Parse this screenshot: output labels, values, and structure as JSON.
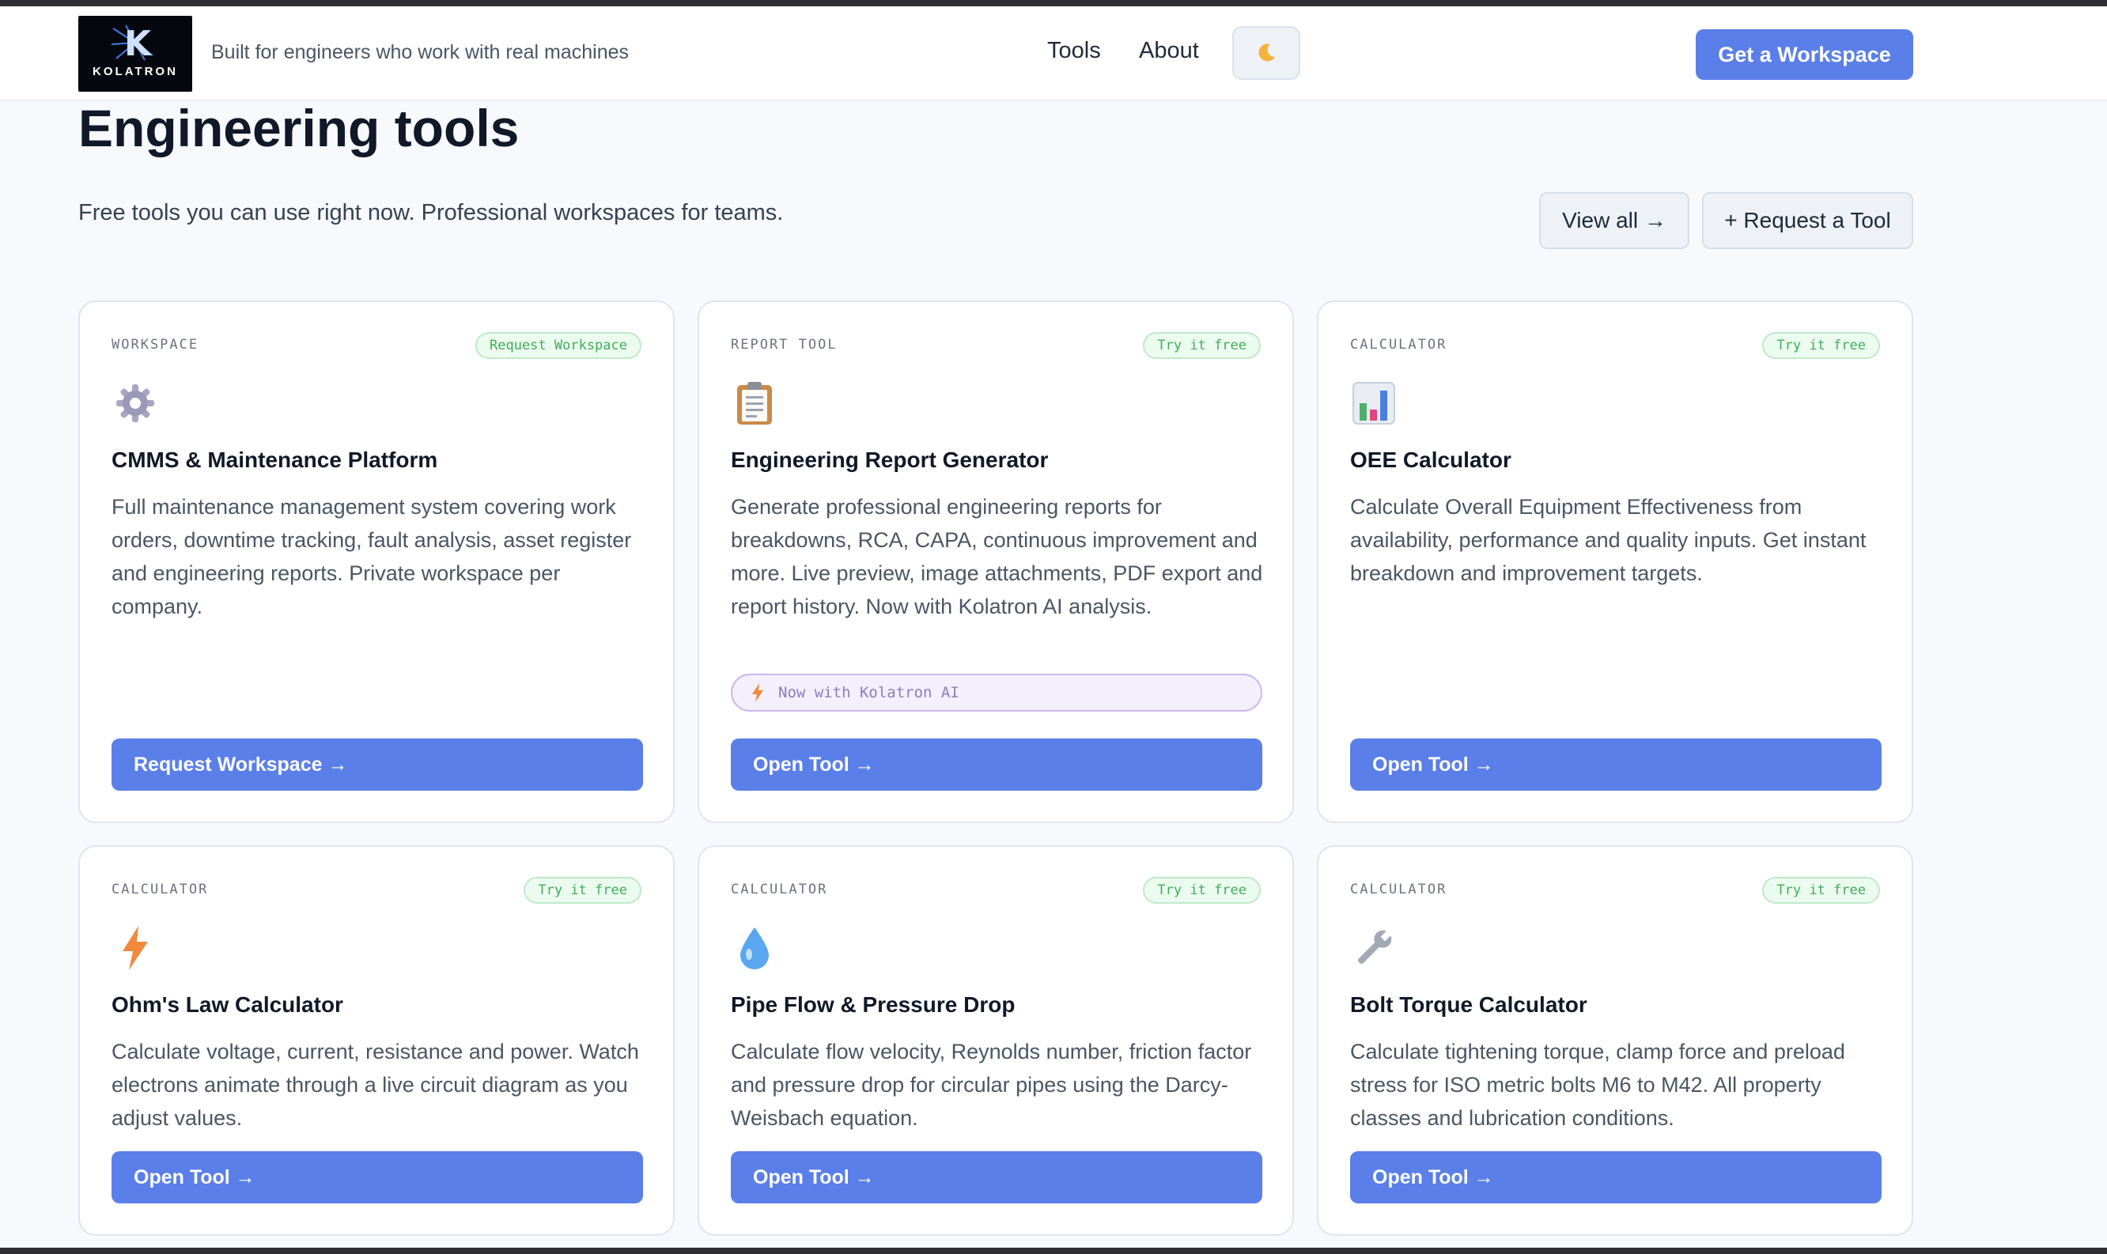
{
  "header": {
    "logo_text": "KOLATRON",
    "tagline": "Built for engineers who work with real machines",
    "nav": [
      "Tools",
      "About"
    ],
    "theme_toggle_icon": "moon-icon",
    "cta_label": "Get a Workspace"
  },
  "main": {
    "title": "Engineering tools",
    "subtitle": "Free tools you can use right now. Professional workspaces for teams.",
    "view_all_label": "View all →",
    "request_tool_label": "+ Request a Tool"
  },
  "cards": [
    {
      "category": "WORKSPACE",
      "badge": "Request Workspace",
      "icon": "gear-icon",
      "title": "CMMS & Maintenance Platform",
      "description": "Full maintenance management system covering work orders, downtime tracking, fault analysis, asset register and engineering reports. Private workspace per company.",
      "action": "Request Workspace →"
    },
    {
      "category": "REPORT TOOL",
      "badge": "Try it free",
      "icon": "clipboard-icon",
      "title": "Engineering Report Generator",
      "description": "Generate professional engineering reports for breakdowns, RCA, CAPA, continuous improvement and more. Live preview, image attachments, PDF export and report history. Now with Kolatron AI analysis.",
      "extra_pill": "Now with Kolatron AI",
      "action": "Open Tool →"
    },
    {
      "category": "CALCULATOR",
      "badge": "Try it free",
      "icon": "bar-chart-icon",
      "title": "OEE Calculator",
      "description": "Calculate Overall Equipment Effectiveness from availability, performance and quality inputs. Get instant breakdown and improvement targets.",
      "action": "Open Tool →"
    },
    {
      "category": "CALCULATOR",
      "badge": "Try it free",
      "icon": "lightning-icon",
      "title": "Ohm's Law Calculator",
      "description": "Calculate voltage, current, resistance and power. Watch electrons animate through a live circuit diagram as you adjust values.",
      "action": "Open Tool →"
    },
    {
      "category": "CALCULATOR",
      "badge": "Try it free",
      "icon": "droplet-icon",
      "title": "Pipe Flow & Pressure Drop",
      "description": "Calculate flow velocity, Reynolds number, friction factor and pressure drop for circular pipes using the Darcy-Weisbach equation.",
      "action": "Open Tool →"
    },
    {
      "category": "CALCULATOR",
      "badge": "Try it free",
      "icon": "wrench-icon",
      "title": "Bolt Torque Calculator",
      "description": "Calculate tightening torque, clamp force and preload stress for ISO metric bolts M6 to M42. All property classes and lubrication conditions.",
      "action": "Open Tool →"
    }
  ],
  "colors": {
    "accent": "#5b7fe8",
    "badge_green": "#3fae5a",
    "page_bg": "#f7f9fc"
  }
}
